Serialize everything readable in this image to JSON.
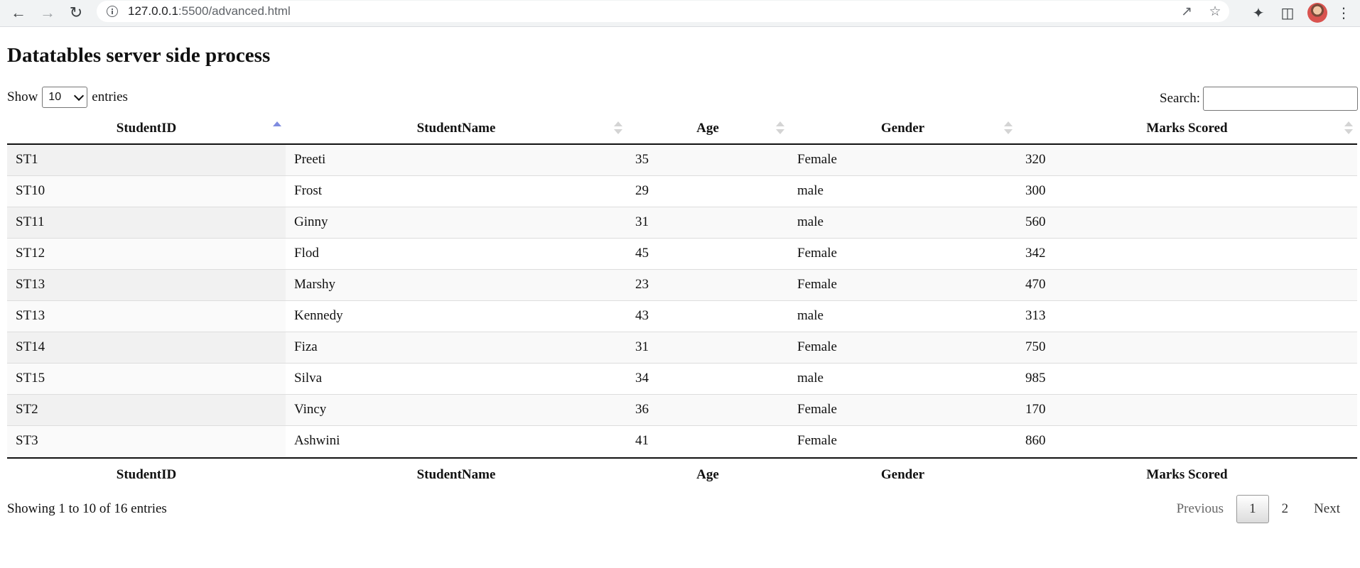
{
  "browser": {
    "url_host": "127.0.0.1",
    "url_path": ":5500/advanced.html"
  },
  "page": {
    "title": "Datatables server side process"
  },
  "length_menu": {
    "show_label": "Show",
    "selected": "10",
    "entries_label": "entries"
  },
  "search": {
    "label": "Search:",
    "value": ""
  },
  "table": {
    "columns": [
      "StudentID",
      "StudentName",
      "Age",
      "Gender",
      "Marks Scored"
    ],
    "sorted_column": "StudentID",
    "sort_direction": "asc",
    "rows": [
      [
        "ST1",
        "Preeti",
        "35",
        "Female",
        "320"
      ],
      [
        "ST10",
        "Frost",
        "29",
        "male",
        "300"
      ],
      [
        "ST11",
        "Ginny",
        "31",
        "male",
        "560"
      ],
      [
        "ST12",
        "Flod",
        "45",
        "Female",
        "342"
      ],
      [
        "ST13",
        "Marshy",
        "23",
        "Female",
        "470"
      ],
      [
        "ST13",
        "Kennedy",
        "43",
        "male",
        "313"
      ],
      [
        "ST14",
        "Fiza",
        "31",
        "Female",
        "750"
      ],
      [
        "ST15",
        "Silva",
        "34",
        "male",
        "985"
      ],
      [
        "ST2",
        "Vincy",
        "36",
        "Female",
        "170"
      ],
      [
        "ST3",
        "Ashwini",
        "41",
        "Female",
        "860"
      ]
    ]
  },
  "info": "Showing 1 to 10 of 16 entries",
  "pagination": {
    "previous": "Previous",
    "pages": [
      "1",
      "2"
    ],
    "current": "1",
    "next": "Next"
  }
}
